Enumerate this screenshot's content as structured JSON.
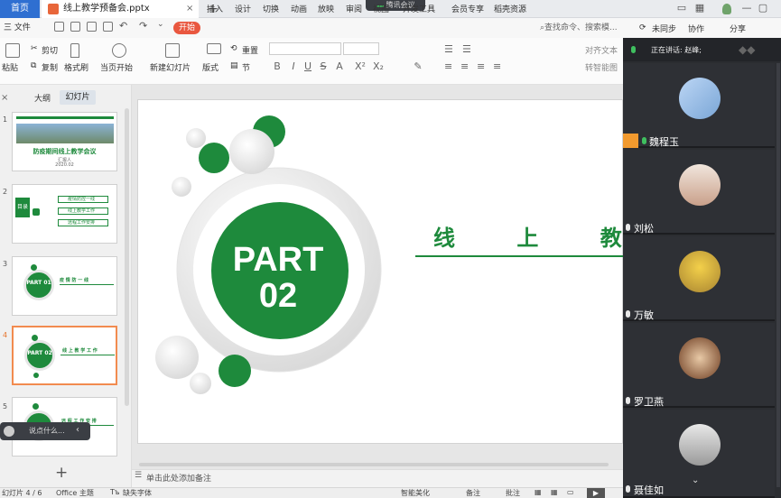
{
  "titlebar": {
    "home_tab": "首页",
    "doc_tab": "线上教学预备会.pptx",
    "close": "×",
    "plus": "+",
    "meeting_app": "腾讯会议"
  },
  "menubar": {
    "file": "三 文件",
    "items": [
      "开始",
      "插入",
      "设计",
      "切换",
      "动画",
      "放映",
      "审阅",
      "视图",
      "开发工具",
      "会员专享",
      "稻壳资源"
    ],
    "search": "查找命令、搜索模..."
  },
  "toolbar_right": {
    "sync": "未同步",
    "collab": "协作",
    "share": "分享"
  },
  "ribbon": {
    "paste": "粘贴",
    "cut": "剪切",
    "copy": "复制",
    "format_painter": "格式刷",
    "from_current": "当页开始",
    "new_slide": "新建幻灯片",
    "layout": "版式",
    "section": "节",
    "reset": "重置",
    "align_text": "对齐文本",
    "convert_smart": "转智能图",
    "format_buttons": [
      "B",
      "I",
      "U",
      "S",
      "A",
      "X²",
      "X₂",
      "✎"
    ]
  },
  "sidebar": {
    "close": "×",
    "outline_tab": "大纲",
    "slides_tab": "幻灯片",
    "slides": [
      {
        "num": "1",
        "title": "防疫期间线上教学会议",
        "sub": "汇报人",
        "date": "2020.02"
      },
      {
        "num": "2",
        "label": "目录",
        "items": [
          "疫情防控一线",
          "线上教学工作",
          "远程工作安排"
        ]
      },
      {
        "num": "3",
        "part": "PART 01",
        "heading": "疫 情 防 一 线"
      },
      {
        "num": "4",
        "part": "PART 02",
        "heading": "线 上 教 学 工 作"
      },
      {
        "num": "5",
        "part": "PART",
        "heading": "远 程 工 作 安 排"
      }
    ],
    "add": "+"
  },
  "floating_input": {
    "placeholder": "说点什么..."
  },
  "slide": {
    "part_line1": "PART",
    "part_line2": "02",
    "title": "线 上 教 学"
  },
  "notes": {
    "placeholder": "单击此处添加备注"
  },
  "statusbar": {
    "slide_count": "幻灯片 4 / 6",
    "theme": "Office 主题",
    "missing_font": "缺失字体",
    "beautify": "智能美化",
    "notes_btn": "备注",
    "comments_btn": "批注"
  },
  "meeting": {
    "speaking_label": "正在讲话: 赵峰;",
    "participants": [
      {
        "name": "魏程玉",
        "muted": false,
        "host": true,
        "avatar_color": "#8fb6e6"
      },
      {
        "name": "刘松",
        "muted": true,
        "host": false,
        "avatar_color": "#d9b9a6"
      },
      {
        "name": "万敏",
        "muted": true,
        "host": false,
        "avatar_color": "#c9a33c"
      },
      {
        "name": "罗卫燕",
        "muted": true,
        "host": false,
        "avatar_color": "#7a4a2c"
      },
      {
        "name": "聂佳如",
        "muted": true,
        "host": false,
        "avatar_color": "#bfbfbf"
      }
    ],
    "more": "⌄"
  },
  "colors": {
    "accent_green": "#1e8a3c",
    "wps_blue": "#2f6fd1",
    "start_orange": "#e9573f",
    "selected_thumb": "#f28b4f",
    "meeting_bg": "#2b2d31",
    "mic_active": "#3fbf5f"
  }
}
